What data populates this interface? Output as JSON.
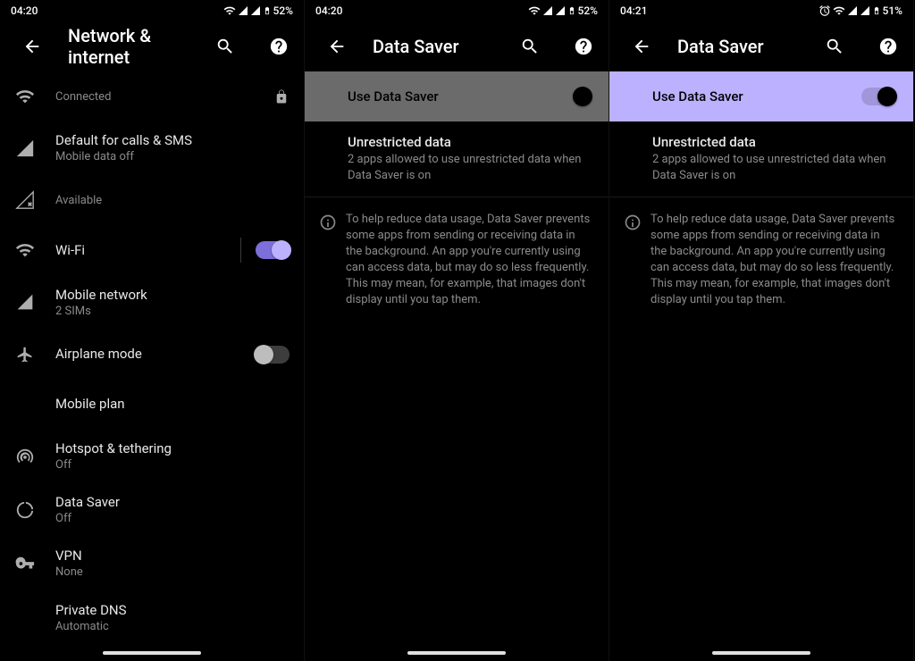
{
  "panels": [
    {
      "status": {
        "time": "04:20",
        "battery": "52%"
      },
      "title": "Network & internet",
      "show_alarm": false,
      "items": [
        {
          "icon": "wifi-strong",
          "title": "",
          "sub": "Connected",
          "lock": true
        },
        {
          "icon": "signal-x",
          "title": "Default for calls & SMS",
          "sub": "Mobile data off"
        },
        {
          "icon": "signal-x-outline",
          "title": "",
          "sub": "Available"
        },
        {
          "icon": "wifi",
          "title": "Wi-Fi",
          "sub": "",
          "toggle": "on",
          "divider": true
        },
        {
          "icon": "signal",
          "title": "Mobile network",
          "sub": "2 SIMs"
        },
        {
          "icon": "airplane",
          "title": "Airplane mode",
          "sub": "",
          "toggle": "off"
        },
        {
          "icon": "none",
          "title": "Mobile plan",
          "sub": ""
        },
        {
          "icon": "hotspot",
          "title": "Hotspot & tethering",
          "sub": "Off"
        },
        {
          "icon": "datasaver",
          "title": "Data Saver",
          "sub": "Off"
        },
        {
          "icon": "vpn",
          "title": "VPN",
          "sub": "None"
        },
        {
          "icon": "none",
          "title": "Private DNS",
          "sub": "Automatic"
        }
      ]
    },
    {
      "status": {
        "time": "04:20",
        "battery": "52%"
      },
      "title": "Data Saver",
      "show_alarm": false,
      "master": {
        "label": "Use Data Saver",
        "style": "gray",
        "state": "transitional"
      },
      "unrestricted_title": "Unrestricted data",
      "unrestricted_sub": "2 apps allowed to use unrestricted data when Data Saver is on",
      "info": "To help reduce data usage, Data Saver prevents some apps from sending or receiving data in the background. An app you're currently using can access data, but may do so less frequently. This may mean, for example, that images don't display until you tap them."
    },
    {
      "status": {
        "time": "04:21",
        "battery": "51%"
      },
      "title": "Data Saver",
      "show_alarm": true,
      "master": {
        "label": "Use Data Saver",
        "style": "purple",
        "state": "on"
      },
      "unrestricted_title": "Unrestricted data",
      "unrestricted_sub": "2 apps allowed to use unrestricted data when Data Saver is on",
      "info": "To help reduce data usage, Data Saver prevents some apps from sending or receiving data in the background. An app you're currently using can access data, but may do so less frequently. This may mean, for example, that images don't display until you tap them."
    }
  ]
}
